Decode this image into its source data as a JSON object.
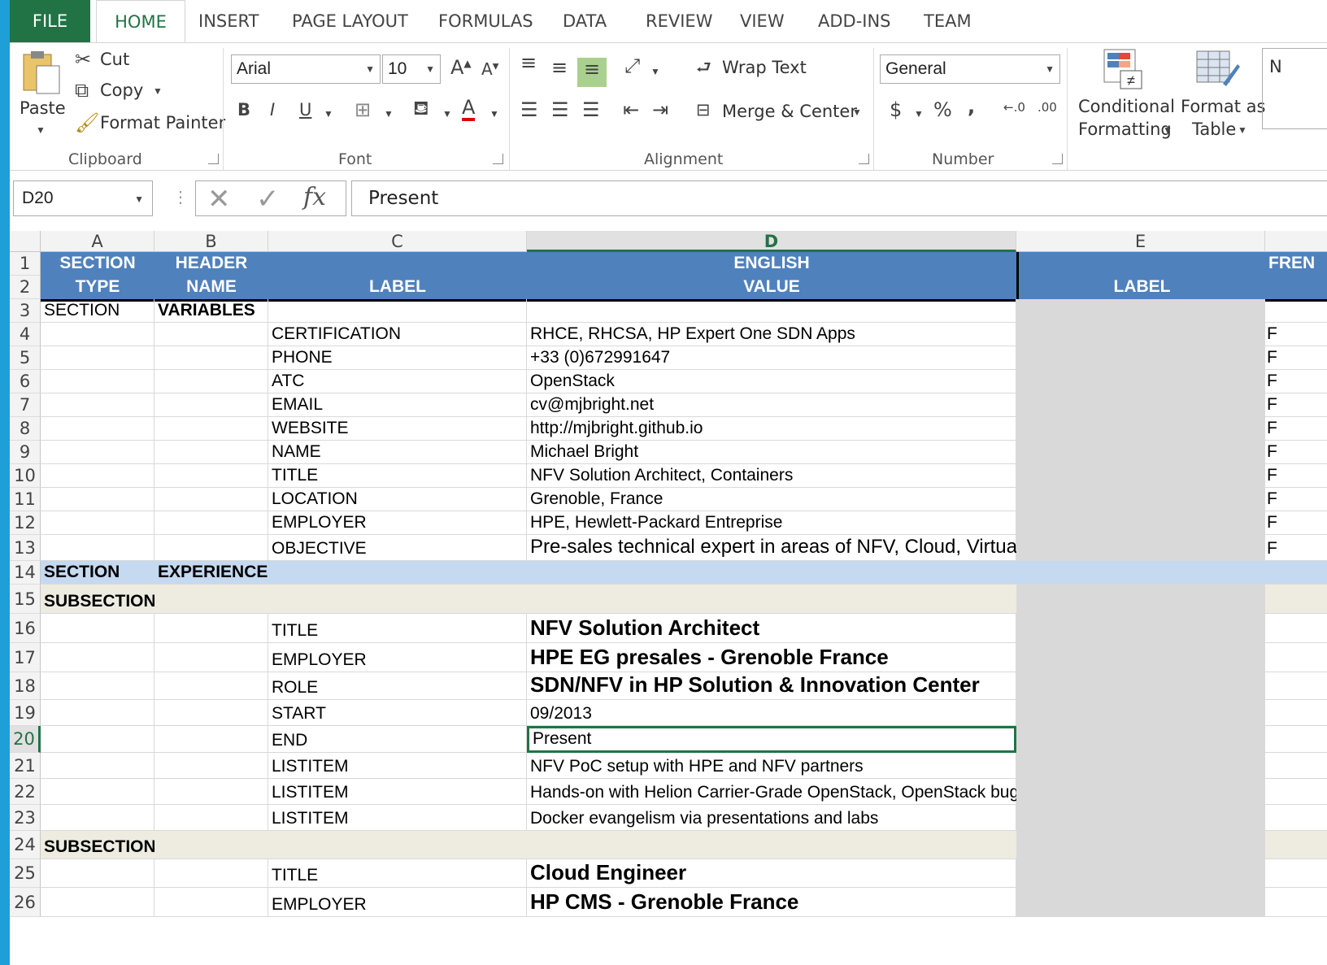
{
  "ribbon_tabs": [
    "FILE",
    "HOME",
    "INSERT",
    "PAGE LAYOUT",
    "FORMULAS",
    "DATA",
    "REVIEW",
    "VIEW",
    "ADD-INS",
    "TEAM"
  ],
  "clipboard": {
    "paste": "Paste",
    "cut": "Cut",
    "copy": "Copy",
    "format_painter": "Format Painter",
    "group": "Clipboard"
  },
  "font": {
    "name": "Arial",
    "size": "10",
    "bold": "B",
    "italic": "I",
    "underline": "U",
    "group": "Font"
  },
  "alignment": {
    "wrap_text": "Wrap Text",
    "merge_center": "Merge & Center",
    "group": "Alignment"
  },
  "number": {
    "format": "General",
    "currency": "$",
    "percent": "%",
    "comma": ",",
    "group": "Number"
  },
  "styles": {
    "conditional_1": "Conditional",
    "conditional_2": "Formatting",
    "format_as_1": "Format as",
    "format_as_2": "Table",
    "more": "N"
  },
  "formula_bar": {
    "name_box": "D20",
    "fx": "fx",
    "content": "Present"
  },
  "columns": [
    "A",
    "B",
    "C",
    "D",
    "E"
  ],
  "header_row1": {
    "a": "SECTION",
    "b": "HEADER",
    "d": "ENGLISH",
    "f": "FREN"
  },
  "header_row2": {
    "a": "TYPE",
    "b": "NAME",
    "c": "LABEL",
    "d": "VALUE",
    "e": "LABEL"
  },
  "rows": [
    {
      "n": "3",
      "a": "SECTION",
      "b": "VARIABLES",
      "c": "",
      "d": ""
    },
    {
      "n": "4",
      "c": "CERTIFICATION",
      "d": "RHCE, RHCSA, HP Expert One SDN Apps",
      "f": "F"
    },
    {
      "n": "5",
      "c": "PHONE",
      "d": "+33 (0)672991647",
      "f": "F"
    },
    {
      "n": "6",
      "c": "ATC",
      "d": "OpenStack",
      "f": "F"
    },
    {
      "n": "7",
      "c": "EMAIL",
      "d": "cv@mjbright.net",
      "f": "F"
    },
    {
      "n": "8",
      "c": "WEBSITE",
      "d": "http://mjbright.github.io",
      "f": "F"
    },
    {
      "n": "9",
      "c": "NAME",
      "d": "Michael Bright",
      "f": "F"
    },
    {
      "n": "10",
      "c": "TITLE",
      "d": "NFV Solution Architect, Containers",
      "f": "F"
    },
    {
      "n": "11",
      "c": "LOCATION",
      "d": "Grenoble, France",
      "f": "F"
    },
    {
      "n": "12",
      "c": "EMPLOYER",
      "d": "HPE, Hewlett-Packard Entreprise",
      "f": "F"
    },
    {
      "n": "13",
      "c": "OBJECTIVE",
      "d": "Pre-sales technical expert in areas of NFV, Cloud, Virtualization, Containers, SDN,",
      "f": "F"
    },
    {
      "n": "14",
      "a": "SECTION",
      "b": "EXPERIENCE"
    },
    {
      "n": "15",
      "a": "SUBSECTION"
    },
    {
      "n": "16",
      "c": "TITLE",
      "d": "NFV Solution Architect"
    },
    {
      "n": "17",
      "c": "EMPLOYER",
      "d": "HPE EG presales - Grenoble France"
    },
    {
      "n": "18",
      "c": "ROLE",
      "d": "SDN/NFV  in HP Solution & Innovation Center"
    },
    {
      "n": "19",
      "c": "START",
      "d": "09/2013"
    },
    {
      "n": "20",
      "c": "END",
      "d": "Present"
    },
    {
      "n": "21",
      "c": "LISTITEM",
      "d": "NFV PoC setup with HPE and NFV partners"
    },
    {
      "n": "22",
      "c": "LISTITEM",
      "d": "Hands-on with Helion Carrier-Grade OpenStack,  OpenStack bug fix"
    },
    {
      "n": "23",
      "c": "LISTITEM",
      "d": "Docker evangelism via presentations and labs"
    },
    {
      "n": "24",
      "a": "SUBSECTION"
    },
    {
      "n": "25",
      "c": "TITLE",
      "d": "Cloud Engineer"
    },
    {
      "n": "26",
      "c": "EMPLOYER",
      "d": "HP CMS - Grenoble France"
    }
  ],
  "colors": {
    "excel_green": "#217346",
    "header_blue": "#4f81bd",
    "section_blue": "#c5d9f1",
    "subsection_beige": "#eeece1"
  }
}
